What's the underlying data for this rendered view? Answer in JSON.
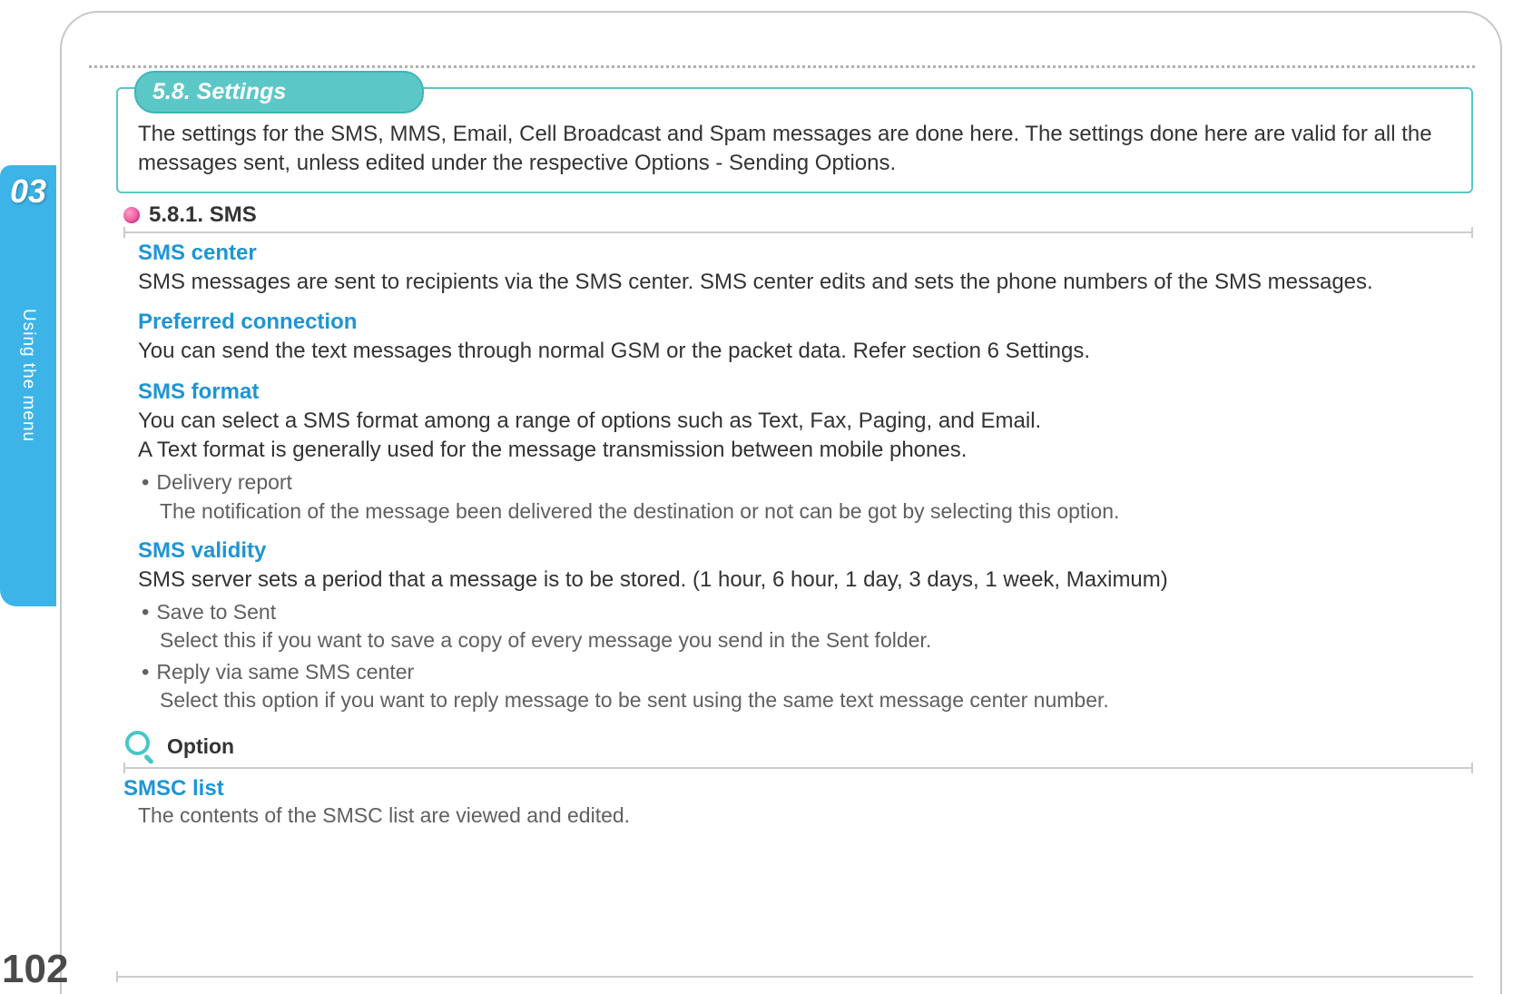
{
  "sidebar": {
    "chapter_number": "03",
    "chapter_title": "Using the menu"
  },
  "page_number": "102",
  "section": {
    "tab_title": "5.8. Settings",
    "intro": "The settings for the SMS, MMS, Email, Cell Broadcast and Spam messages are done here. The settings done here are valid for all the messages sent, unless edited under the respective Options - Sending Options."
  },
  "subsection": {
    "title": "5.8.1. SMS"
  },
  "topics": {
    "sms_center": {
      "heading": "SMS center",
      "body": "SMS messages are sent to recipients via the SMS center. SMS center edits and sets the phone numbers of the SMS messages."
    },
    "preferred_connection": {
      "heading": "Preferred connection",
      "body": "You can send the text messages through normal GSM or the packet data. Refer section 6 Settings."
    },
    "sms_format": {
      "heading": "SMS format",
      "body_line1": "You can select a SMS format among a range of options such as Text, Fax, Paging, and Email.",
      "body_line2": "A Text format is generally used for the message transmission between mobile phones.",
      "bullet1_title": "Delivery report",
      "bullet1_body": "The notification of the message been delivered the destination or not can be got by selecting this option."
    },
    "sms_validity": {
      "heading": "SMS validity",
      "body": "SMS server sets a period that a message is to be stored. (1 hour, 6 hour, 1 day, 3 days, 1 week, Maximum)",
      "bullet1_title": "Save to Sent",
      "bullet1_body": "Select this if you want to save a copy of every message you send in the Sent folder.",
      "bullet2_title": "Reply via same SMS center",
      "bullet2_body": "Select this option if you want to reply message to be sent using the same text message center number."
    }
  },
  "option": {
    "label": "Option",
    "smsc_heading": "SMSC list",
    "smsc_body": "The contents of the SMSC list are viewed and edited."
  }
}
